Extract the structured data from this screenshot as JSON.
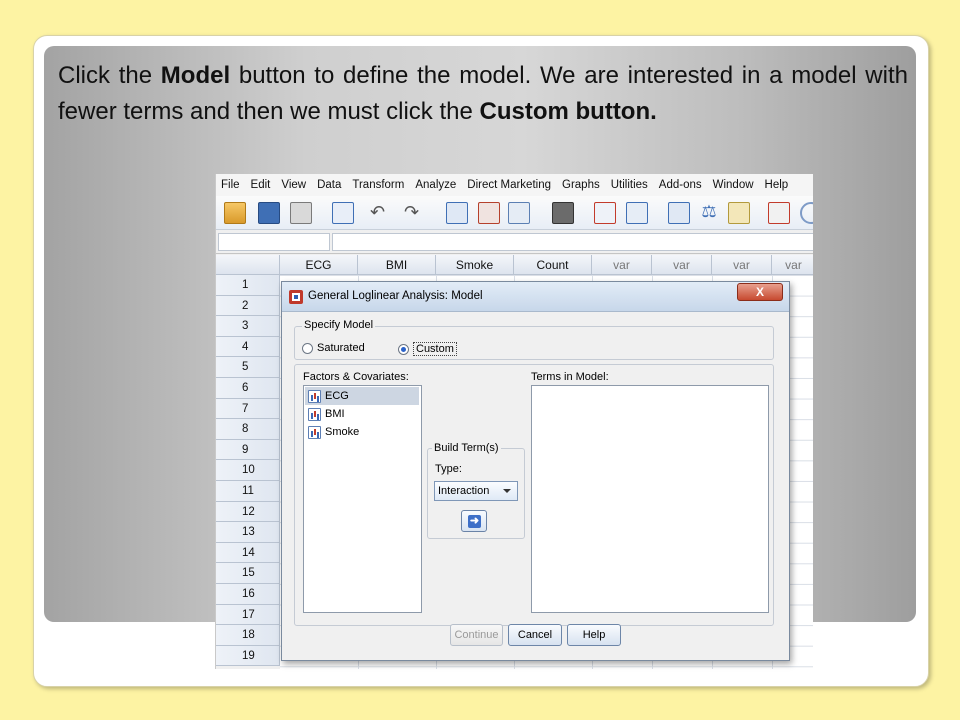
{
  "slide": {
    "text_part1": "Click the ",
    "text_bold1": "Model",
    "text_part2": " button to define the model. We are interested in a model with fewer terms and then we must click the ",
    "text_bold2": "Custom button."
  },
  "app": {
    "menu": [
      "File",
      "Edit",
      "View",
      "Data",
      "Transform",
      "Analyze",
      "Direct Marketing",
      "Graphs",
      "Utilities",
      "Add-ons",
      "Window",
      "Help"
    ],
    "columns": [
      "ECG",
      "BMI",
      "Smoke",
      "Count",
      "var",
      "var",
      "var",
      "var"
    ],
    "rows": [
      "1",
      "2",
      "3",
      "4",
      "5",
      "6",
      "7",
      "8",
      "9",
      "10",
      "11",
      "12",
      "13",
      "14",
      "15",
      "16",
      "17",
      "18",
      "19"
    ]
  },
  "dialog": {
    "title": "General Loglinear Analysis: Model",
    "close_label": "X",
    "specify_model": {
      "legend": "Specify Model",
      "saturated": "Saturated",
      "custom": "Custom",
      "selected": "Custom"
    },
    "factors_label": "Factors & Covariates:",
    "factors": [
      "ECG",
      "BMI",
      "Smoke"
    ],
    "selected_factor": "ECG",
    "terms_label": "Terms in Model:",
    "build_terms": {
      "legend": "Build Term(s)",
      "type_label": "Type:",
      "type_value": "Interaction"
    },
    "buttons": {
      "continue": "Continue",
      "cancel": "Cancel",
      "help": "Help"
    }
  }
}
